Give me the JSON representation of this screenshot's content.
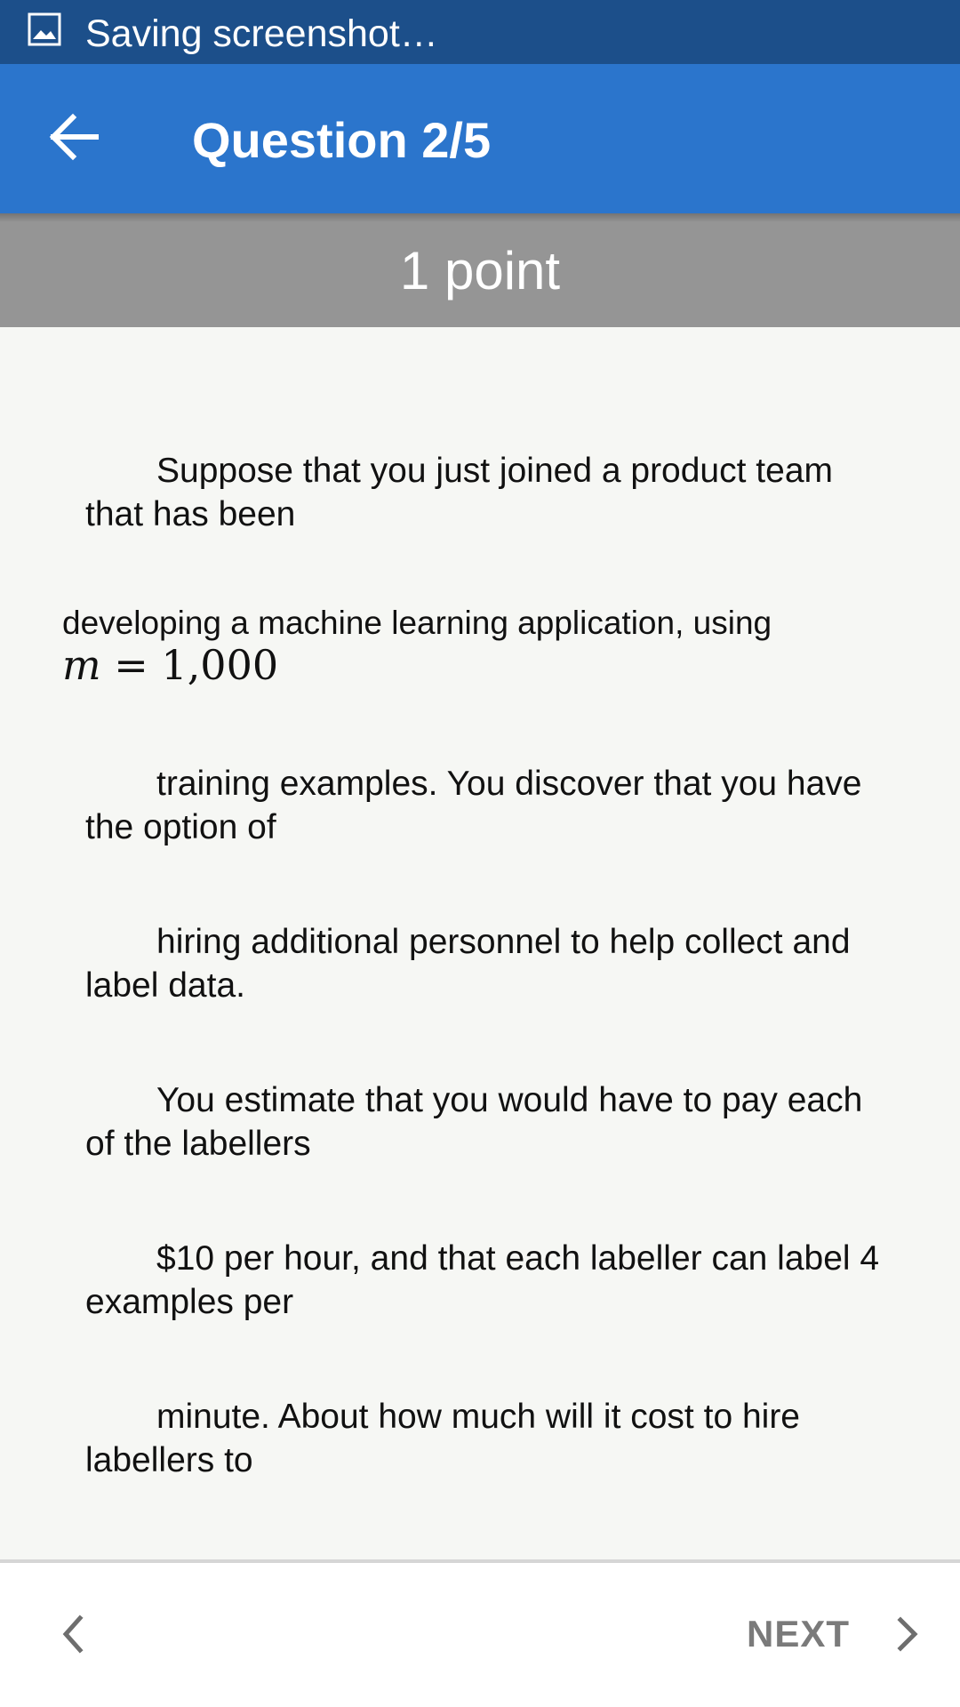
{
  "status_bar": {
    "icon": "image-icon",
    "text": "Saving screenshot…",
    "background": "#1c4f8a"
  },
  "app_bar": {
    "back_icon": "arrow-left-icon",
    "title": "Question 2/5",
    "background": "#2b75cc"
  },
  "points_bar": {
    "label": "1 point",
    "background": "#959595"
  },
  "question": {
    "paragraphs": [
      "Suppose that you just joined a product team that has been",
      "developing a machine learning application, using",
      "training examples.  You discover that you have the option of",
      "hiring additional personnel to help collect and label data.",
      "You estimate that you would have to pay each of the labellers",
      "$10 per hour, and that each labeller can label 4 examples per",
      "minute.  About how much will it cost to hire labellers to"
    ],
    "math": {
      "variable": "m",
      "equals": "=",
      "value": "1,000"
    }
  },
  "bottom_nav": {
    "prev_icon": "chevron-left-icon",
    "next_label": "NEXT",
    "next_icon": "chevron-right-icon"
  }
}
